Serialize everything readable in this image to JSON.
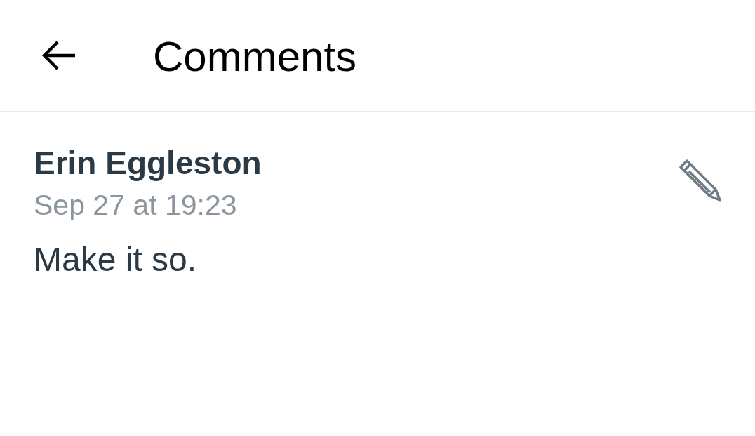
{
  "header": {
    "title": "Comments"
  },
  "comments": [
    {
      "author": "Erin Eggleston",
      "time": "Sep 27 at 19:23",
      "text": "Make it so."
    }
  ]
}
